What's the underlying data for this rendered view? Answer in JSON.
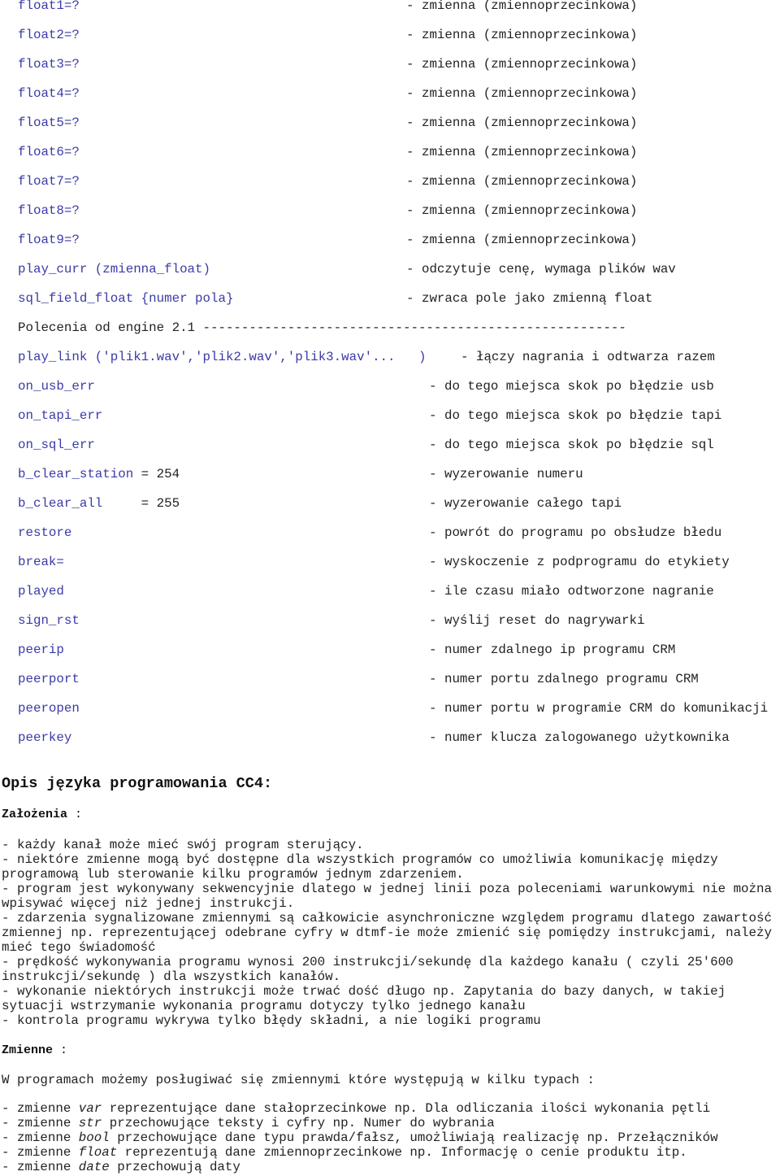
{
  "reference_rows": [
    {
      "left": "float1=?",
      "right": "- zmienna (zmiennoprzecinkowa)"
    },
    {
      "left": "float2=?",
      "right": "- zmienna (zmiennoprzecinkowa)"
    },
    {
      "left": "float3=?",
      "right": "- zmienna (zmiennoprzecinkowa)"
    },
    {
      "left": "float4=?",
      "right": "- zmienna (zmiennoprzecinkowa)"
    },
    {
      "left": "float5=?",
      "right": "- zmienna (zmiennoprzecinkowa)"
    },
    {
      "left": "float6=?",
      "right": "- zmienna (zmiennoprzecinkowa)"
    },
    {
      "left": "float7=?",
      "right": "- zmienna (zmiennoprzecinkowa)"
    },
    {
      "left": "float8=?",
      "right": "- zmienna (zmiennoprzecinkowa)"
    },
    {
      "left": "float9=?",
      "right": "- zmienna (zmiennoprzecinkowa)"
    },
    {
      "left": "play_curr (zmienna_float)",
      "right": "- odczytuje cenę, wymaga plików wav"
    },
    {
      "left": "sql_field_float {numer pola}",
      "right": "- zwraca pole jako zmienną float"
    },
    {
      "section": "Polecenia od engine 2.1 -------------------------------------------------------"
    },
    {
      "left": "play_link ('plik1.wav','plik2.wav','plik3.wav'...   )",
      "right": "- łączy nagrania i odtwarza razem",
      "wide": true
    },
    {
      "left": "on_usb_err",
      "right": "- do tego miejsca skok po błędzie usb"
    },
    {
      "left": "on_tapi_err",
      "right": "- do tego miejsca skok po błędzie tapi"
    },
    {
      "left": "on_sql_err",
      "right": "- do tego miejsca skok po błędzie sql"
    },
    {
      "left": "b_clear_station",
      "value": " = 254",
      "right": "- wyzerowanie numeru"
    },
    {
      "left": "b_clear_all",
      "value": "     = 255",
      "right": "- wyzerowanie całego tapi"
    },
    {
      "left": "restore",
      "right": "- powrót do programu po obsłudze błedu"
    },
    {
      "left": "break=",
      "right": "- wyskoczenie z podprogramu do etykiety"
    },
    {
      "left": "played",
      "right": "- ile czasu miało odtworzone nagranie"
    },
    {
      "left": "sign_rst",
      "right": "- wyślij reset do nagrywarki"
    },
    {
      "left": "peerip",
      "right": "- numer zdalnego ip programu CRM"
    },
    {
      "left": "peerport",
      "right": "- numer portu zdalnego programu CRM"
    },
    {
      "left": "peeropen",
      "right": "- numer portu w programie CRM do komunikacji"
    },
    {
      "left": "peerkey",
      "right": "- numer klucza zalogowanego użytkownika"
    }
  ],
  "title": "Opis języka programowania CC4:",
  "assumptions": {
    "heading": "Założenia",
    "heading_suffix": " :",
    "lines": [
      "- każdy kanał może mieć swój program sterujący.",
      "- niektóre zmienne mogą być dostępne dla wszystkich programów co umożliwia komunikację między",
      "programową lub sterowanie kilku programów jednym zdarzeniem.",
      "- program jest wykonywany sekwencyjnie dlatego w jednej linii poza poleceniami warunkowymi nie można",
      "wpisywać więcej niż jednej instrukcji.",
      "- zdarzenia sygnalizowane zmiennymi są całkowicie asynchroniczne względem programu dlatego zawartość",
      "zmiennej np. reprezentującej odebrane cyfry w dtmf-ie może zmienić się pomiędzy instrukcjami, należy",
      "mieć tego świadomość",
      "- prędkość wykonywania programu wynosi 200 instrukcji/sekundę dla każdego kanału ( czyli 25'600",
      "instrukcji/sekundę ) dla wszystkich kanałów.",
      "- wykonanie niektórych instrukcji może trwać dość długo np. Zapytania do bazy danych, w takiej",
      "sytuacji wstrzymanie wykonania programu dotyczy tylko jednego kanału",
      "- kontrola programu wykrywa tylko błędy składni, a nie logiki programu"
    ]
  },
  "variables": {
    "heading": "Zmienne",
    "heading_suffix": " :",
    "intro": "W programach możemy posługiwać się zmiennymi które występują w kilku typach :",
    "types": [
      {
        "prefix": "- zmienne ",
        "type": "var",
        "rest": " reprezentujące dane stałoprzecinkowe np. Dla odliczania ilości wykonania pętli"
      },
      {
        "prefix": "- zmienne ",
        "type": "str",
        "rest": " przechowujące teksty i cyfry np. Numer do wybrania"
      },
      {
        "prefix": "- zmienne ",
        "type": "bool",
        "rest": " przechowujące dane typu prawda/fałsz, umożliwiają realizację np. Przełączników"
      },
      {
        "prefix": "- zmienne ",
        "type": "float",
        "rest": " reprezentują dane zmiennoprzecinkowe np. Informację o cenie produktu itp."
      },
      {
        "prefix": "- zmienne ",
        "type": "date",
        "rest": " przechowują daty"
      }
    ]
  },
  "colors": {
    "keyword": "#3a3aa8",
    "text": "#222222"
  }
}
